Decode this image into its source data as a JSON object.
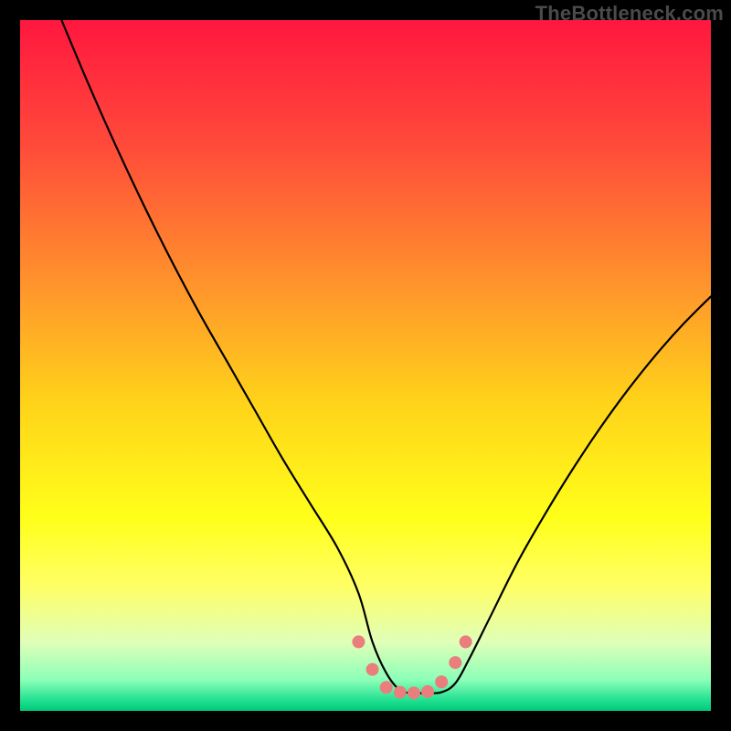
{
  "watermark": "TheBottleneck.com",
  "chart_data": {
    "type": "line",
    "title": "",
    "xlabel": "",
    "ylabel": "",
    "xlim": [
      0,
      100
    ],
    "ylim": [
      0,
      100
    ],
    "legend": false,
    "grid": false,
    "background_gradient_stops": [
      {
        "offset": 0.0,
        "color": "#ff173f"
      },
      {
        "offset": 0.18,
        "color": "#ff4a3a"
      },
      {
        "offset": 0.4,
        "color": "#ff9a2a"
      },
      {
        "offset": 0.55,
        "color": "#ffd21a"
      },
      {
        "offset": 0.72,
        "color": "#ffff1a"
      },
      {
        "offset": 0.82,
        "color": "#ffff66"
      },
      {
        "offset": 0.9,
        "color": "#e0ffb8"
      },
      {
        "offset": 0.955,
        "color": "#8cffb8"
      },
      {
        "offset": 0.985,
        "color": "#20e090"
      },
      {
        "offset": 1.0,
        "color": "#00c878"
      }
    ],
    "series": [
      {
        "name": "main-curve",
        "color": "#000000",
        "stroke_width": 2.2,
        "x": [
          6.0,
          10,
          14,
          18,
          22,
          26,
          30,
          34,
          38,
          42,
          46,
          49,
          51,
          53,
          55,
          57,
          59,
          61,
          63,
          65,
          68,
          72,
          76,
          80,
          84,
          88,
          92,
          96,
          100
        ],
        "y": [
          100,
          90.5,
          81.5,
          73.0,
          65.0,
          57.5,
          50.5,
          43.5,
          36.5,
          30.0,
          23.5,
          17.0,
          10.0,
          5.5,
          3.0,
          2.6,
          2.6,
          2.7,
          4.0,
          7.5,
          13.5,
          21.5,
          28.5,
          35.0,
          41.0,
          46.5,
          51.5,
          56.0,
          60.0
        ]
      }
    ],
    "markers": {
      "name": "trough-markers",
      "color": "#ea7e7d",
      "radius": 7,
      "points": [
        {
          "x": 49.0,
          "y": 10.0
        },
        {
          "x": 51.0,
          "y": 6.0
        },
        {
          "x": 53.0,
          "y": 3.4
        },
        {
          "x": 55.0,
          "y": 2.7
        },
        {
          "x": 57.0,
          "y": 2.6
        },
        {
          "x": 59.0,
          "y": 2.8
        },
        {
          "x": 61.0,
          "y": 4.2
        },
        {
          "x": 63.0,
          "y": 7.0
        },
        {
          "x": 64.5,
          "y": 10.0
        }
      ]
    }
  }
}
